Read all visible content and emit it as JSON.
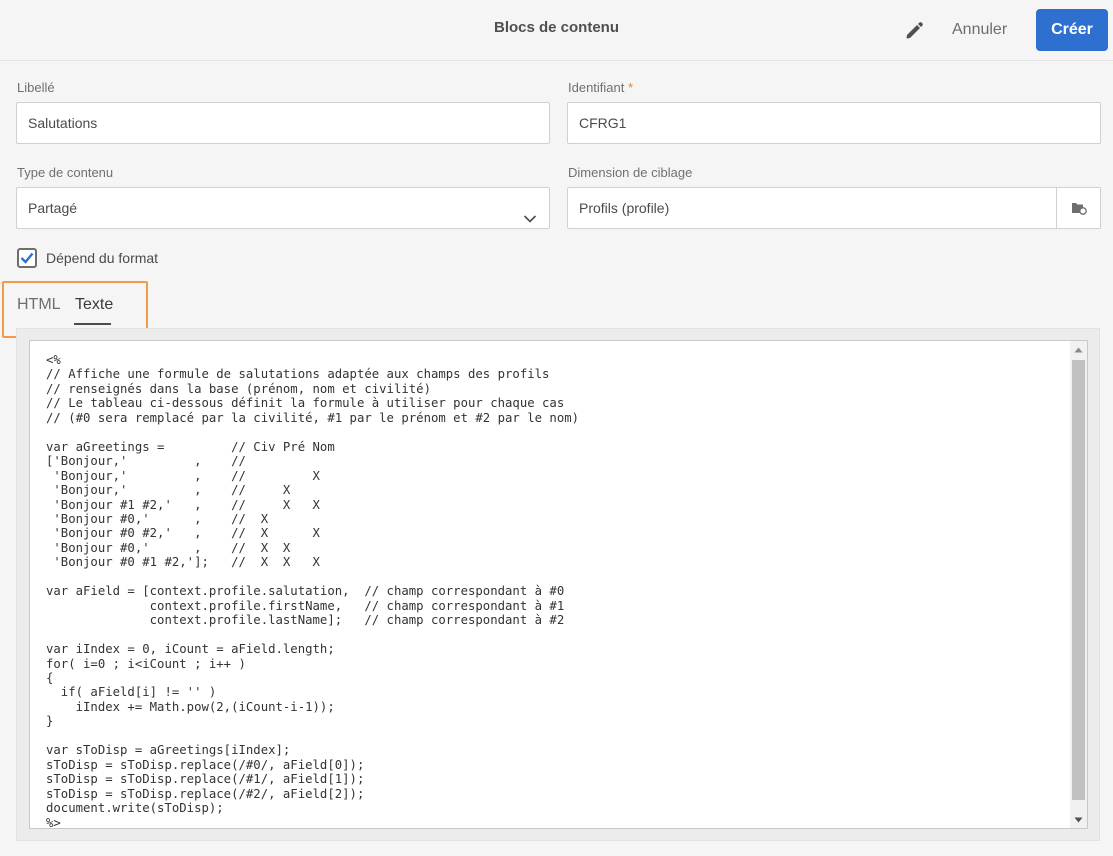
{
  "header": {
    "title": "Blocs de contenu",
    "edit_icon": "pencil-icon",
    "cancel_label": "Annuler",
    "create_label": "Créer",
    "accent_color": "#2d70cf"
  },
  "form": {
    "label_field": {
      "label": "Libellé",
      "value": "Salutations"
    },
    "id_field": {
      "label": "Identifiant",
      "required_mark": "*",
      "value": "CFRG1"
    },
    "content_type": {
      "label": "Type de contenu",
      "value": "Partagé"
    },
    "targeting": {
      "label": "Dimension de ciblage",
      "value": "Profils (profile)"
    },
    "format_checkbox": {
      "label": "Dépend du format",
      "checked": true
    }
  },
  "tabs": [
    {
      "label": "HTML",
      "active": false
    },
    {
      "label": "Texte",
      "active": true
    }
  ],
  "highlight_color": "#f39a4a",
  "editor": {
    "code": "<%\n// Affiche une formule de salutations adaptée aux champs des profils\n// renseignés dans la base (prénom, nom et civilité)\n// Le tableau ci-dessous définit la formule à utiliser pour chaque cas\n// (#0 sera remplacé par la civilité, #1 par le prénom et #2 par le nom)\n\nvar aGreetings =         // Civ Pré Nom\n['Bonjour,'         ,    //\n 'Bonjour,'         ,    //         X\n 'Bonjour,'         ,    //     X\n 'Bonjour #1 #2,'   ,    //     X   X\n 'Bonjour #0,'      ,    //  X\n 'Bonjour #0 #2,'   ,    //  X      X\n 'Bonjour #0,'      ,    //  X  X\n 'Bonjour #0 #1 #2,'];   //  X  X   X\n\nvar aField = [context.profile.salutation,  // champ correspondant à #0\n              context.profile.firstName,   // champ correspondant à #1\n              context.profile.lastName];   // champ correspondant à #2\n\nvar iIndex = 0, iCount = aField.length;\nfor( i=0 ; i<iCount ; i++ )\n{\n  if( aField[i] != '' )\n    iIndex += Math.pow(2,(iCount-i-1));\n}\n\nvar sToDisp = aGreetings[iIndex];\nsToDisp = sToDisp.replace(/#0/, aField[0]);\nsToDisp = sToDisp.replace(/#1/, aField[1]);\nsToDisp = sToDisp.replace(/#2/, aField[2]);\ndocument.write(sToDisp);\n%>"
  }
}
